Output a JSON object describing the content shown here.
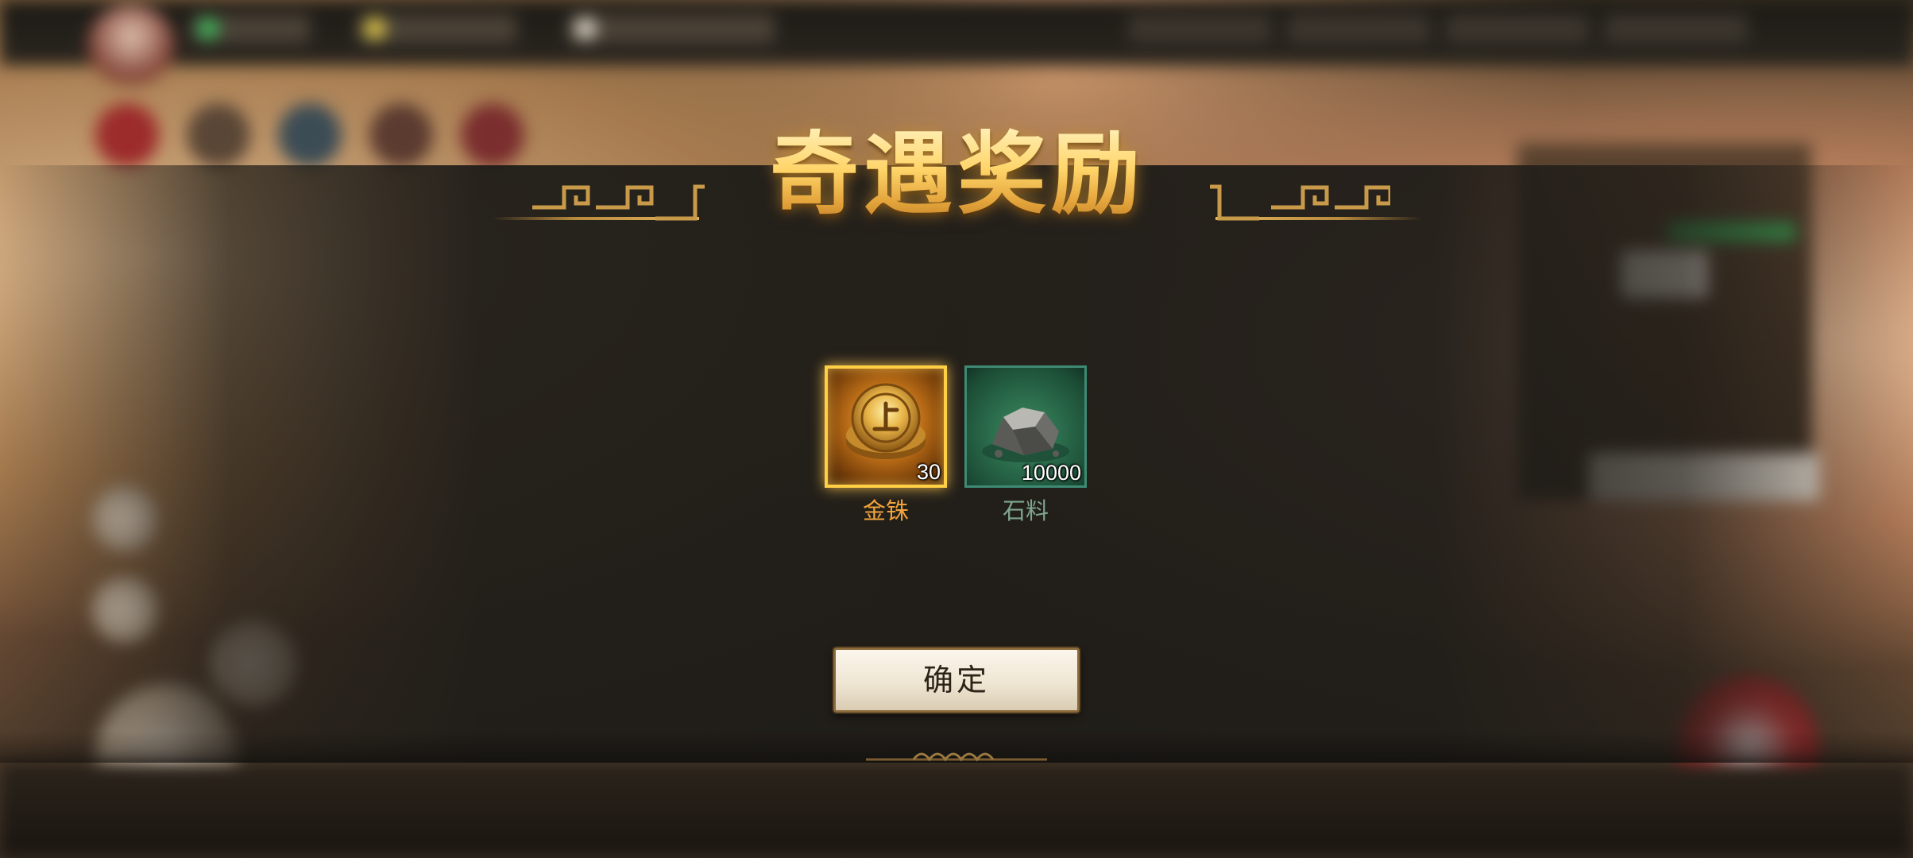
{
  "dialog": {
    "title": "奇遇奖励",
    "confirm_label": "确定"
  },
  "rewards": [
    {
      "name": "金铢",
      "count": "30",
      "icon": "gold-coin-icon",
      "rarity_color": "#ffcf45"
    },
    {
      "name": "石料",
      "count": "10000",
      "icon": "stone-icon",
      "rarity_color": "#3e8a74"
    }
  ],
  "colors": {
    "title_gold": "#ffd777",
    "gold_name": "#f0a33a",
    "green_name": "#7fa58e",
    "button_text": "#2d2419"
  }
}
